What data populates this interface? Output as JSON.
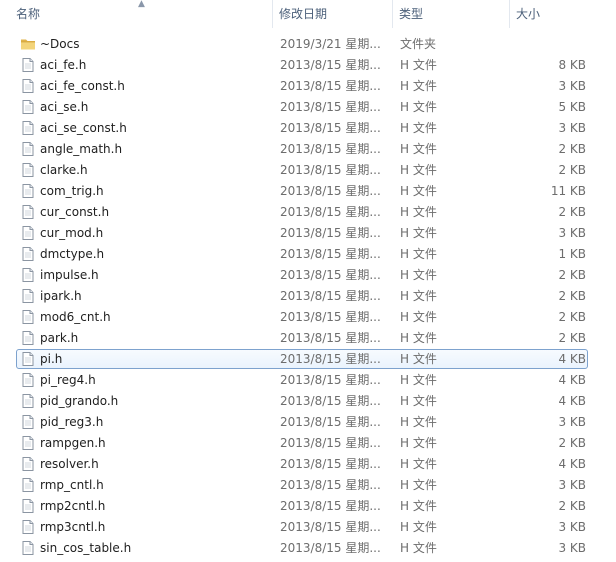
{
  "columns": {
    "name": "名称",
    "date": "修改日期",
    "type": "类型",
    "size": "大小"
  },
  "colors": {
    "header_text": "#4c607a",
    "selection_border": "#7da2ce",
    "folder": "#e8c15a"
  },
  "files": [
    {
      "name": "~Docs",
      "date": "2019/3/21 星期...",
      "type": "文件夹",
      "size": "",
      "icon": "folder-icon"
    },
    {
      "name": "aci_fe.h",
      "date": "2013/8/15 星期...",
      "type": "H 文件",
      "size": "8 KB",
      "icon": "file-icon"
    },
    {
      "name": "aci_fe_const.h",
      "date": "2013/8/15 星期...",
      "type": "H 文件",
      "size": "3 KB",
      "icon": "file-icon"
    },
    {
      "name": "aci_se.h",
      "date": "2013/8/15 星期...",
      "type": "H 文件",
      "size": "5 KB",
      "icon": "file-icon"
    },
    {
      "name": "aci_se_const.h",
      "date": "2013/8/15 星期...",
      "type": "H 文件",
      "size": "3 KB",
      "icon": "file-icon"
    },
    {
      "name": "angle_math.h",
      "date": "2013/8/15 星期...",
      "type": "H 文件",
      "size": "2 KB",
      "icon": "file-icon"
    },
    {
      "name": "clarke.h",
      "date": "2013/8/15 星期...",
      "type": "H 文件",
      "size": "2 KB",
      "icon": "file-icon"
    },
    {
      "name": "com_trig.h",
      "date": "2013/8/15 星期...",
      "type": "H 文件",
      "size": "11 KB",
      "icon": "file-icon"
    },
    {
      "name": "cur_const.h",
      "date": "2013/8/15 星期...",
      "type": "H 文件",
      "size": "2 KB",
      "icon": "file-icon"
    },
    {
      "name": "cur_mod.h",
      "date": "2013/8/15 星期...",
      "type": "H 文件",
      "size": "3 KB",
      "icon": "file-icon"
    },
    {
      "name": "dmctype.h",
      "date": "2013/8/15 星期...",
      "type": "H 文件",
      "size": "1 KB",
      "icon": "file-icon"
    },
    {
      "name": "impulse.h",
      "date": "2013/8/15 星期...",
      "type": "H 文件",
      "size": "2 KB",
      "icon": "file-icon"
    },
    {
      "name": "ipark.h",
      "date": "2013/8/15 星期...",
      "type": "H 文件",
      "size": "2 KB",
      "icon": "file-icon"
    },
    {
      "name": "mod6_cnt.h",
      "date": "2013/8/15 星期...",
      "type": "H 文件",
      "size": "2 KB",
      "icon": "file-icon"
    },
    {
      "name": "park.h",
      "date": "2013/8/15 星期...",
      "type": "H 文件",
      "size": "2 KB",
      "icon": "file-icon"
    },
    {
      "name": "pi.h",
      "date": "2013/8/15 星期...",
      "type": "H 文件",
      "size": "4 KB",
      "icon": "file-icon",
      "selected": true
    },
    {
      "name": "pi_reg4.h",
      "date": "2013/8/15 星期...",
      "type": "H 文件",
      "size": "4 KB",
      "icon": "file-icon"
    },
    {
      "name": "pid_grando.h",
      "date": "2013/8/15 星期...",
      "type": "H 文件",
      "size": "4 KB",
      "icon": "file-icon"
    },
    {
      "name": "pid_reg3.h",
      "date": "2013/8/15 星期...",
      "type": "H 文件",
      "size": "3 KB",
      "icon": "file-icon"
    },
    {
      "name": "rampgen.h",
      "date": "2013/8/15 星期...",
      "type": "H 文件",
      "size": "2 KB",
      "icon": "file-icon"
    },
    {
      "name": "resolver.h",
      "date": "2013/8/15 星期...",
      "type": "H 文件",
      "size": "4 KB",
      "icon": "file-icon"
    },
    {
      "name": "rmp_cntl.h",
      "date": "2013/8/15 星期...",
      "type": "H 文件",
      "size": "3 KB",
      "icon": "file-icon"
    },
    {
      "name": "rmp2cntl.h",
      "date": "2013/8/15 星期...",
      "type": "H 文件",
      "size": "2 KB",
      "icon": "file-icon"
    },
    {
      "name": "rmp3cntl.h",
      "date": "2013/8/15 星期...",
      "type": "H 文件",
      "size": "3 KB",
      "icon": "file-icon"
    },
    {
      "name": "sin_cos_table.h",
      "date": "2013/8/15 星期...",
      "type": "H 文件",
      "size": "3 KB",
      "icon": "file-icon"
    }
  ]
}
